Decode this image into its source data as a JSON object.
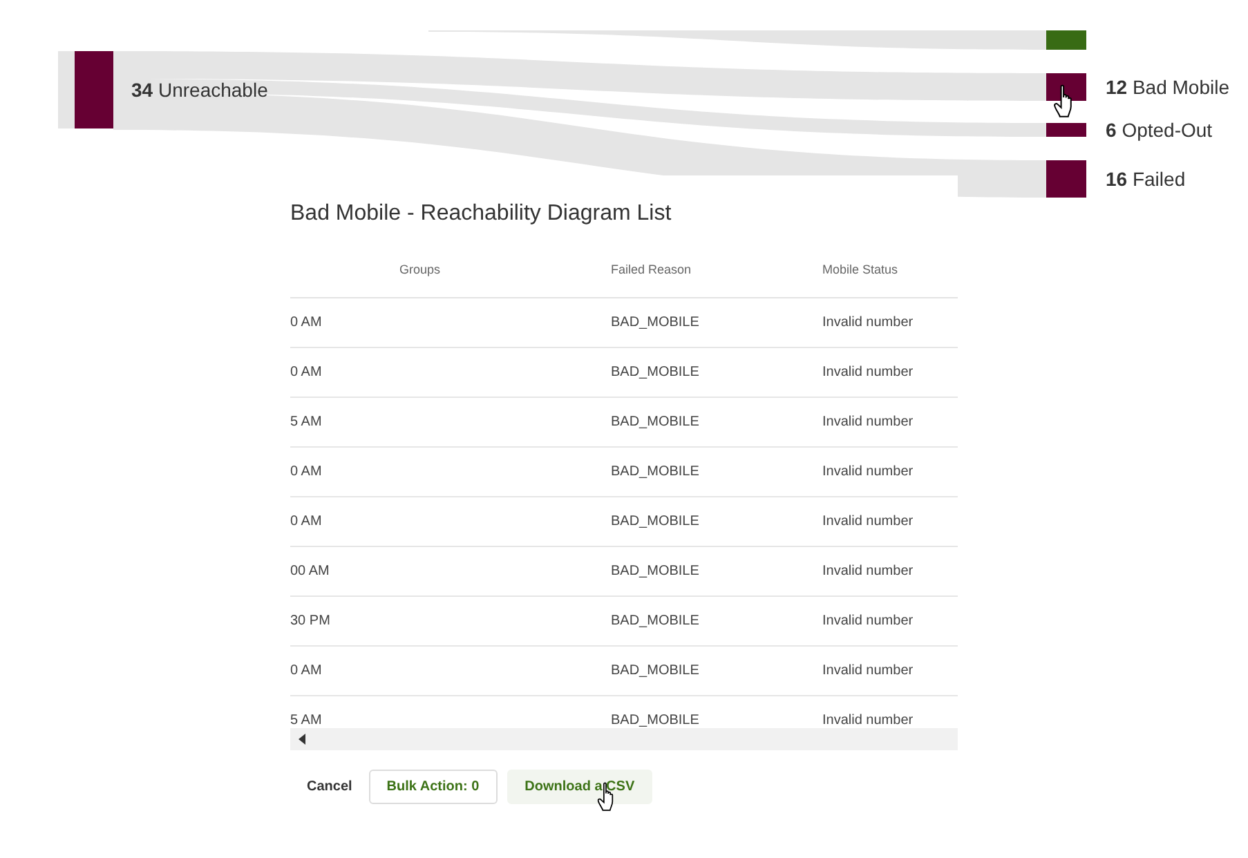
{
  "diagram": {
    "source": {
      "value": "34",
      "label": "Unreachable",
      "color": "#660033"
    },
    "targets": [
      {
        "color": "#386b14"
      },
      {
        "value": "12",
        "label": "Bad Mobile",
        "color": "#660033"
      },
      {
        "value": "6",
        "label": "Opted-Out",
        "color": "#660033"
      },
      {
        "value": "16",
        "label": "Failed",
        "color": "#660033"
      }
    ]
  },
  "dialog": {
    "title": "Bad Mobile - Reachability Diagram List",
    "columns": [
      "Groups",
      "Failed Reason",
      "Mobile Status"
    ],
    "rows": [
      {
        "column_1": "0 AM",
        "failed_reason": "BAD_MOBILE",
        "mobile_status": "Invalid number"
      },
      {
        "column_1": "0 AM",
        "failed_reason": "BAD_MOBILE",
        "mobile_status": "Invalid number"
      },
      {
        "column_1": "5 AM",
        "failed_reason": "BAD_MOBILE",
        "mobile_status": "Invalid number"
      },
      {
        "column_1": "0 AM",
        "failed_reason": "BAD_MOBILE",
        "mobile_status": "Invalid number"
      },
      {
        "column_1": "0 AM",
        "failed_reason": "BAD_MOBILE",
        "mobile_status": "Invalid number"
      },
      {
        "column_1": "00 AM",
        "failed_reason": "BAD_MOBILE",
        "mobile_status": "Invalid number"
      },
      {
        "column_1": "30 PM",
        "failed_reason": "BAD_MOBILE",
        "mobile_status": "Invalid number"
      },
      {
        "column_1": "0 AM",
        "failed_reason": "BAD_MOBILE",
        "mobile_status": "Invalid number"
      },
      {
        "column_1": "5 AM",
        "failed_reason": "BAD_MOBILE",
        "mobile_status": "Invalid number"
      }
    ],
    "buttons": [
      {
        "label": "Cancel",
        "kind": "text"
      },
      {
        "label": "Bulk Action: 0",
        "kind": "outlined"
      },
      {
        "label": "Download a CSV",
        "kind": "filled"
      }
    ]
  }
}
